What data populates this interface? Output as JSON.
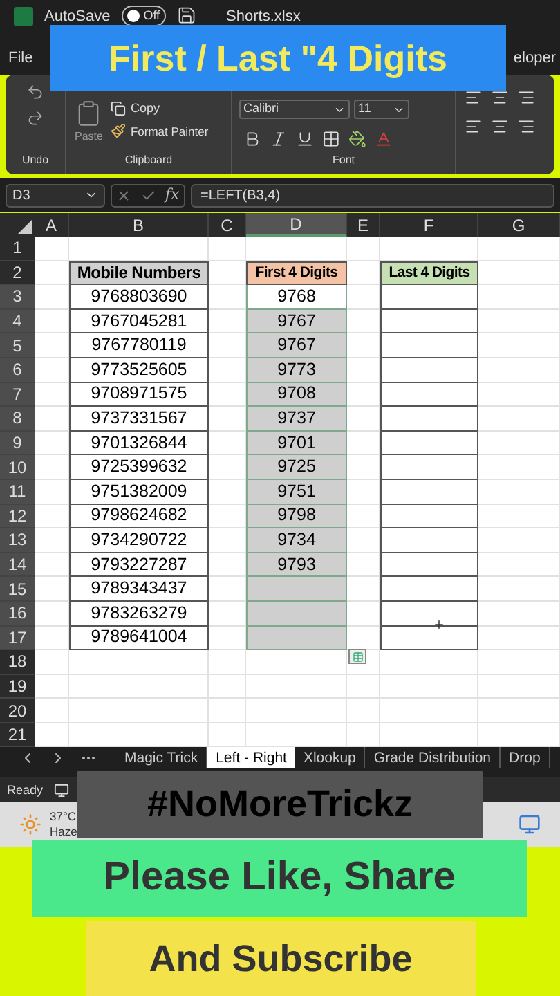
{
  "title_bar": {
    "autosave_label": "AutoSave",
    "autosave_state": "Off",
    "autosave_on": false,
    "file_name": "Shorts.xlsx"
  },
  "banner": "First / Last \"4 Digits",
  "ribbon_tabs": [
    "File",
    "eloper"
  ],
  "ribbon": {
    "undo_label": "Undo",
    "paste": "Paste",
    "copy": "Copy",
    "format_painter": "Format Painter",
    "clipboard_label": "Clipboard",
    "font_name": "Calibri",
    "font_size": "11",
    "font_label": "Font"
  },
  "formula_bar": {
    "name_box": "D3",
    "function_label": "fx",
    "formula": "=LEFT(B3,4)"
  },
  "columns": [
    {
      "label": "A",
      "selected": false
    },
    {
      "label": "B",
      "selected": false
    },
    {
      "label": "C",
      "selected": false
    },
    {
      "label": "D",
      "selected": true
    },
    {
      "label": "E",
      "selected": false
    },
    {
      "label": "F",
      "selected": false
    },
    {
      "label": "G",
      "selected": false
    }
  ],
  "row_headers": [
    {
      "label": "1",
      "selected": false
    },
    {
      "label": "2",
      "selected": false
    },
    {
      "label": "3",
      "selected": true
    },
    {
      "label": "4",
      "selected": true
    },
    {
      "label": "5",
      "selected": true
    },
    {
      "label": "6",
      "selected": true
    },
    {
      "label": "7",
      "selected": true
    },
    {
      "label": "8",
      "selected": true
    },
    {
      "label": "9",
      "selected": true
    },
    {
      "label": "10",
      "selected": true
    },
    {
      "label": "11",
      "selected": true
    },
    {
      "label": "12",
      "selected": true
    },
    {
      "label": "13",
      "selected": true
    },
    {
      "label": "14",
      "selected": true
    },
    {
      "label": "15",
      "selected": true
    },
    {
      "label": "16",
      "selected": true
    },
    {
      "label": "17",
      "selected": true
    },
    {
      "label": "18",
      "selected": false
    },
    {
      "label": "19",
      "selected": false
    },
    {
      "label": "20",
      "selected": false
    },
    {
      "label": "21",
      "selected": false
    }
  ],
  "table": {
    "headers": [
      "Mobile Numbers",
      "First 4 Digits",
      "Last 4 Digits"
    ],
    "rows": [
      {
        "mobile": "9768803690",
        "first4": "9768",
        "active": true
      },
      {
        "mobile": "9767045281",
        "first4": "9767",
        "active": false
      },
      {
        "mobile": "9767780119",
        "first4": "9767",
        "active": false
      },
      {
        "mobile": "9773525605",
        "first4": "9773",
        "active": false
      },
      {
        "mobile": "9708971575",
        "first4": "9708",
        "active": false
      },
      {
        "mobile": "9737331567",
        "first4": "9737",
        "active": false
      },
      {
        "mobile": "9701326844",
        "first4": "9701",
        "active": false
      },
      {
        "mobile": "9725399632",
        "first4": "9725",
        "active": false
      },
      {
        "mobile": "9751382009",
        "first4": "9751",
        "active": false
      },
      {
        "mobile": "9798624682",
        "first4": "9798",
        "active": false
      },
      {
        "mobile": "9734290722",
        "first4": "9734",
        "active": false
      },
      {
        "mobile": "9793227287",
        "first4": "9793",
        "active": false
      },
      {
        "mobile": "9789343437",
        "active": false
      },
      {
        "mobile": "9783263279",
        "active": false
      },
      {
        "mobile": "9789641004",
        "active": false
      }
    ]
  },
  "sheet_tabs": [
    {
      "label": "Magic Trick",
      "selected": false
    },
    {
      "label": "Left - Right",
      "selected": true
    },
    {
      "label": "Xlookup",
      "selected": false
    },
    {
      "label": "Grade Distribution",
      "selected": false
    },
    {
      "label": "Drop",
      "selected": false
    }
  ],
  "status": "Ready",
  "weather": {
    "temperature": "37°C",
    "condition": "Haze"
  },
  "overlays": {
    "hashtag": "#NoMoreTrickz",
    "like_share": "Please Like, Share",
    "subscribe": "And Subscribe"
  }
}
